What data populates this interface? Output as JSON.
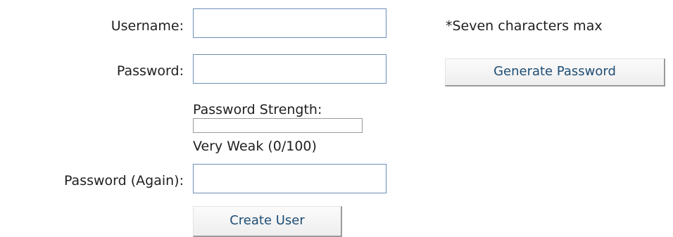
{
  "form": {
    "username": {
      "label": "Username:",
      "value": "",
      "note": "*Seven characters max"
    },
    "password": {
      "label": "Password:",
      "value": "",
      "generate_label": "Generate Password"
    },
    "strength": {
      "title": "Password Strength:",
      "status": "Very Weak (0/100)",
      "level": 0
    },
    "password_again": {
      "label": "Password (Again):",
      "value": ""
    },
    "create_label": "Create User"
  }
}
